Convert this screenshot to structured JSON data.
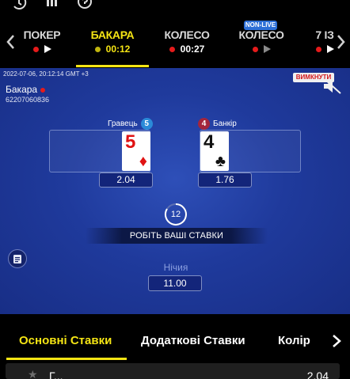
{
  "games": [
    {
      "name": "ПОКЕР",
      "time": ""
    },
    {
      "name": "БАКАРА",
      "time": "00:12"
    },
    {
      "name": "КОЛЕСО",
      "time": "00:27"
    },
    {
      "name": "КОЛЕСО",
      "time": "",
      "badge": "NON-LIVE"
    },
    {
      "name": "7 ІЗ",
      "time": ""
    }
  ],
  "table": {
    "timestamp": "2022-07-06, 20:12:14 GMT +3",
    "name": "Бакара",
    "id": "62207060836",
    "mute_label": "ВИМКНУТИ",
    "player": {
      "label": "Гравець",
      "score": "5",
      "card_rank": "5",
      "card_suit": "♦",
      "odds": "2.04"
    },
    "banker": {
      "label": "Банкір",
      "score": "4",
      "card_rank": "4",
      "card_suit": "♣",
      "odds": "1.76"
    },
    "countdown": "12",
    "place_bets": "РОБІТЬ ВАШІ СТАВКИ",
    "tie": {
      "label": "Нічия",
      "odds": "11.00"
    }
  },
  "tabs": [
    "Основні Ставки",
    "Додаткові Ставки",
    "Колір"
  ],
  "bet_row": {
    "label": "Г...",
    "odds": "2.04"
  },
  "colors": {
    "accent": "#f5e514",
    "live": "#e51b1b",
    "table": "#1f3a9c",
    "badge": "#2d6fd6"
  },
  "icons": [
    "history-icon",
    "stats-icon",
    "help-icon",
    "chevron-left-icon",
    "chevron-right-icon",
    "play-icon",
    "mute-icon",
    "chat-icon",
    "star-icon"
  ]
}
